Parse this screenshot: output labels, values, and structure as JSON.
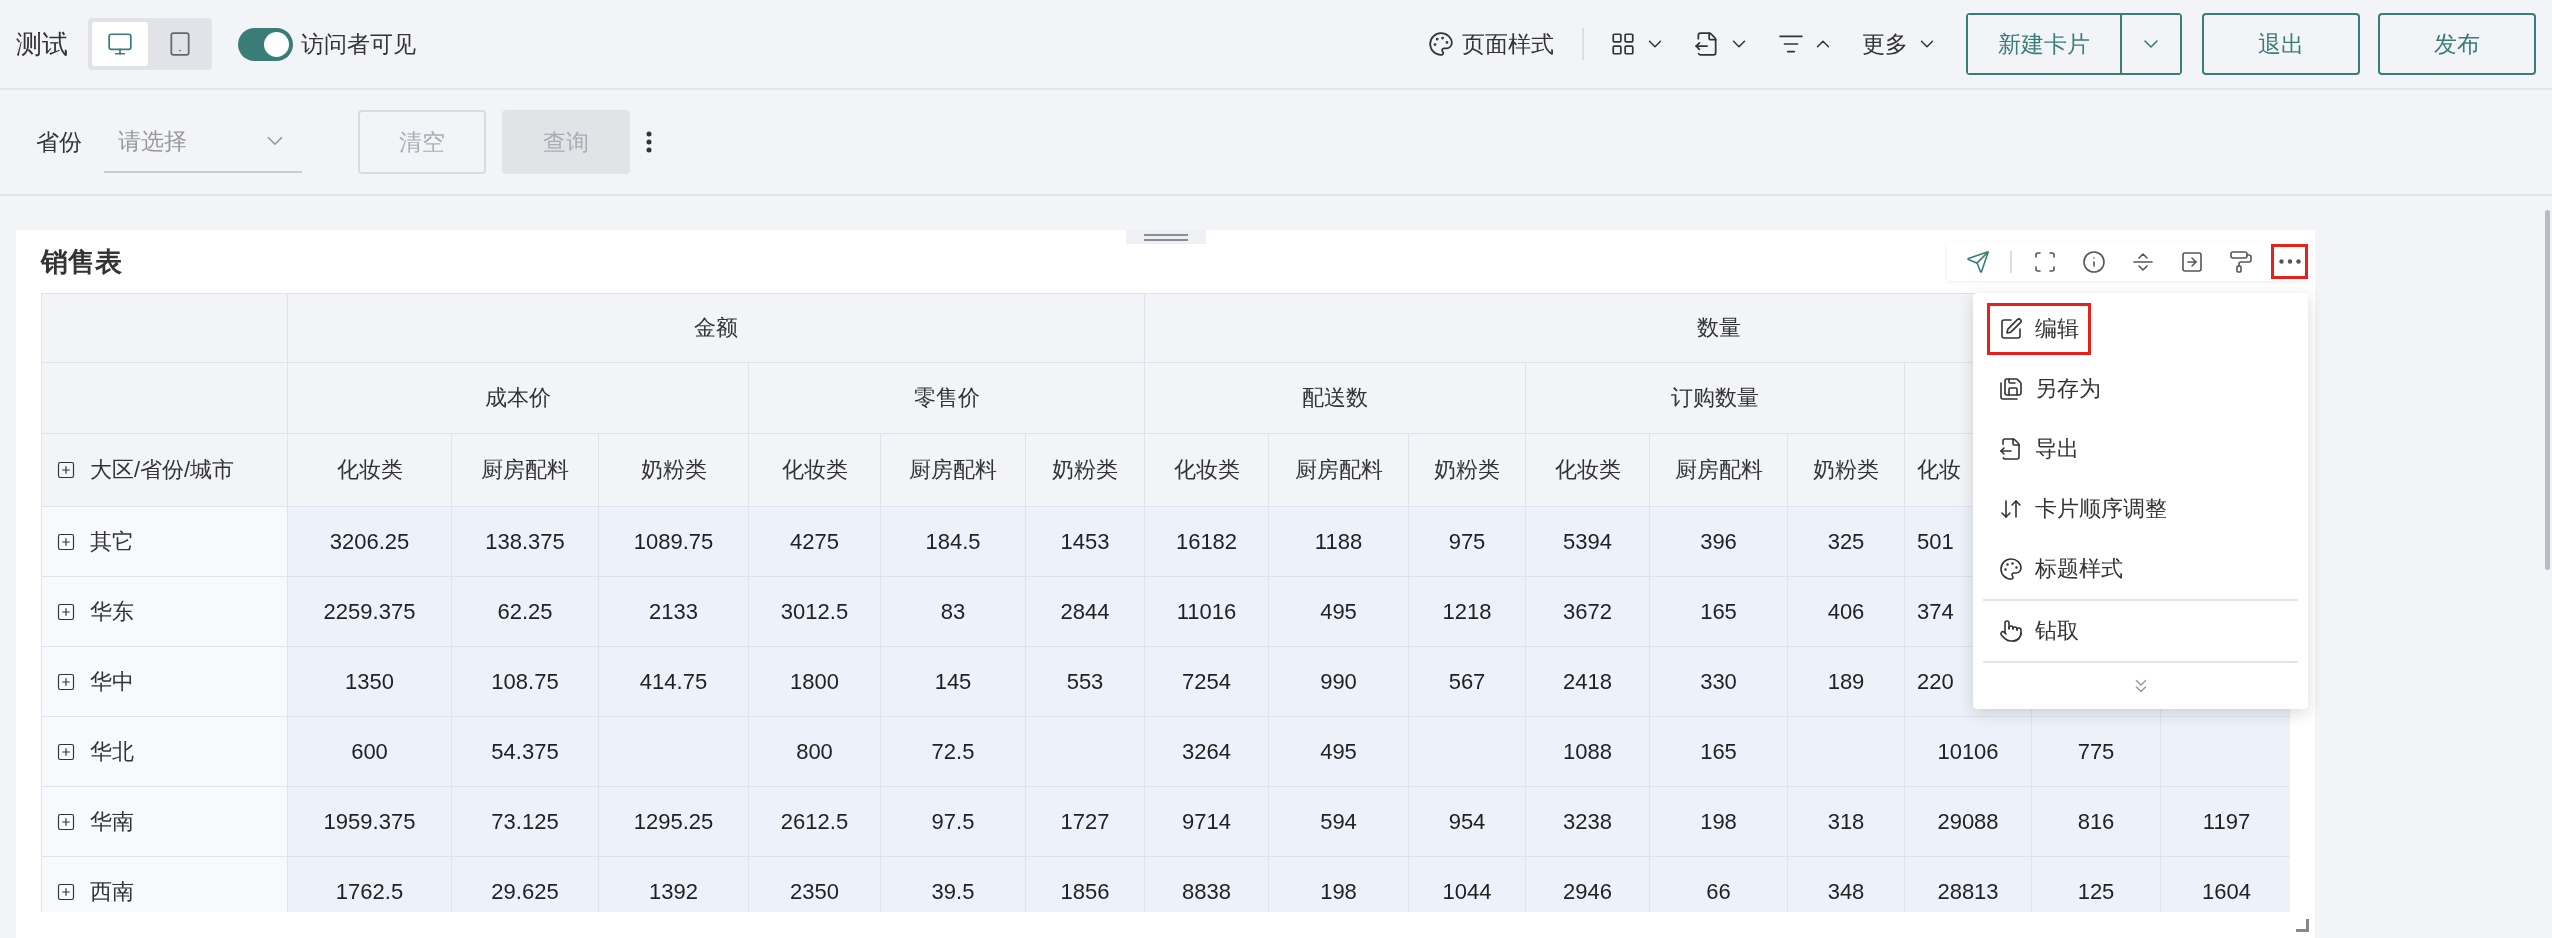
{
  "header": {
    "title": "测试",
    "device_modes": [
      {
        "kind": "desktop",
        "selected": true
      },
      {
        "kind": "mobile",
        "selected": false
      }
    ],
    "visitor_toggle": {
      "label": "访问者可见",
      "on": true
    },
    "page_style": {
      "label": "页面样式"
    },
    "tools": [
      {
        "kind": "layout",
        "expanded": false
      },
      {
        "kind": "export",
        "expanded": false
      },
      {
        "kind": "filter",
        "expanded": true
      }
    ],
    "more": {
      "label": "更多",
      "expanded": false
    },
    "new_card": {
      "label": "新建卡片"
    },
    "buttons": [
      {
        "label": "退出"
      },
      {
        "label": "发布"
      }
    ]
  },
  "filter_bar": {
    "field": {
      "label": "省份",
      "placeholder": "请选择"
    },
    "buttons": [
      {
        "label": "清空",
        "kind": "outline",
        "disabled": true
      },
      {
        "label": "查询",
        "kind": "filled",
        "disabled": true
      }
    ]
  },
  "card": {
    "title": "销售表",
    "tools": [
      {
        "kind": "send",
        "highlighted": false
      },
      {
        "kind": "fullscreen",
        "highlighted": false
      },
      {
        "kind": "info",
        "highlighted": false
      },
      {
        "kind": "split",
        "highlighted": false
      },
      {
        "kind": "insert",
        "highlighted": false
      },
      {
        "kind": "painter",
        "highlighted": false
      },
      {
        "kind": "more",
        "highlighted": true
      }
    ],
    "menu": {
      "sections": [
        {
          "items": [
            {
              "kind": "edit",
              "label": "编辑",
              "highlighted": true
            },
            {
              "kind": "save-as",
              "label": "另存为",
              "highlighted": false
            },
            {
              "kind": "export",
              "label": "导出",
              "highlighted": false
            },
            {
              "kind": "reorder",
              "label": "卡片顺序调整",
              "highlighted": false
            },
            {
              "kind": "title-style",
              "label": "标题样式",
              "highlighted": false
            }
          ]
        },
        {
          "items": [
            {
              "kind": "drill",
              "label": "钻取",
              "highlighted": false
            }
          ]
        }
      ]
    },
    "table": {
      "corner_header": "大区/省份/城市",
      "corner_expanded": false,
      "groups": [
        {
          "label": "金额",
          "subgroups": [
            {
              "label": "成本价",
              "columns": [
                "化妆类",
                "厨房配料",
                "奶粉类"
              ]
            },
            {
              "label": "零售价",
              "columns": [
                "化妆类",
                "厨房配料",
                "奶粉类"
              ]
            }
          ]
        },
        {
          "label": "数量",
          "subgroups": [
            {
              "label": "配送数",
              "columns": [
                "化妆类",
                "厨房配料",
                "奶粉类"
              ]
            },
            {
              "label": "订购数量",
              "columns": [
                "化妆类",
                "厨房配料",
                "奶粉类"
              ]
            },
            {
              "columns": [
                "化妆",
                null,
                null
              ],
              "partial": true
            }
          ]
        }
      ],
      "rows": [
        {
          "region": "其它",
          "expanded": false,
          "partial": true,
          "cells": [
            "3206.25",
            "138.375",
            "1089.75",
            "4275",
            "184.5",
            "1453",
            "16182",
            "1188",
            "975",
            "5394",
            "396",
            "325",
            "501",
            null,
            null
          ]
        },
        {
          "region": "华东",
          "expanded": false,
          "partial": true,
          "cells": [
            "2259.375",
            "62.25",
            "2133",
            "3012.5",
            "83",
            "2844",
            "11016",
            "495",
            "1218",
            "3672",
            "165",
            "406",
            "374",
            null,
            null
          ]
        },
        {
          "region": "华中",
          "expanded": false,
          "partial": true,
          "cells": [
            "1350",
            "108.75",
            "414.75",
            "1800",
            "145",
            "553",
            "7254",
            "990",
            "567",
            "2418",
            "330",
            "189",
            "220",
            null,
            null
          ]
        },
        {
          "region": "华北",
          "expanded": false,
          "cells": [
            "600",
            "54.375",
            null,
            "800",
            "72.5",
            null,
            "3264",
            "495",
            null,
            "1088",
            "165",
            null,
            "10106",
            "775",
            null
          ]
        },
        {
          "region": "华南",
          "expanded": false,
          "cells": [
            "1959.375",
            "73.125",
            "1295.25",
            "2612.5",
            "97.5",
            "1727",
            "9714",
            "594",
            "954",
            "3238",
            "198",
            "318",
            "29088",
            "816",
            "1197"
          ]
        },
        {
          "region": "西南",
          "expanded": false,
          "cells": [
            "1762.5",
            "29.625",
            "1392",
            "2350",
            "39.5",
            "1856",
            "8838",
            "198",
            "1044",
            "2946",
            "66",
            "348",
            "28813",
            "125",
            "1604"
          ]
        }
      ]
    }
  }
}
